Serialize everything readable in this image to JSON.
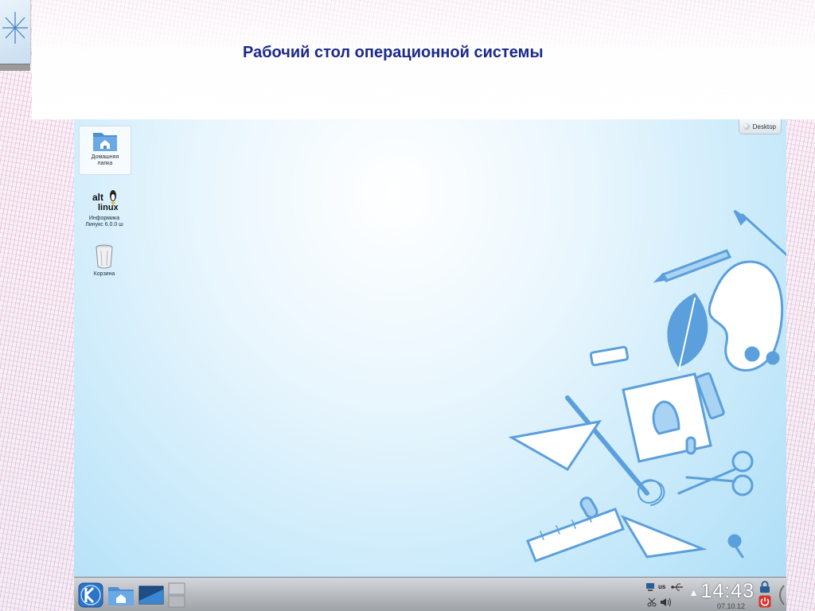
{
  "slide": {
    "title": "Рабочий стол операционной системы"
  },
  "desktop": {
    "widget_label": "Desktop",
    "icons": [
      {
        "name": "folder-home-icon",
        "label_line1": "Домашняя",
        "label_line2": "папка",
        "selected": true
      },
      {
        "name": "alt-linux-icon",
        "label_line1": "Информика",
        "label_line2": "Линукс 6.0.0 ш"
      },
      {
        "name": "trash-icon",
        "label_line1": "Корзина",
        "label_line2": ""
      }
    ],
    "logo_text_top": "alt",
    "logo_text_bottom": "linux"
  },
  "taskbar": {
    "keyboard_layout": "us",
    "time": "14:43",
    "date": "07.10.12"
  },
  "colors": {
    "title": "#1b2a8a",
    "desktop_art": "#5b9fdc",
    "kde_button": "#2a74c9"
  }
}
